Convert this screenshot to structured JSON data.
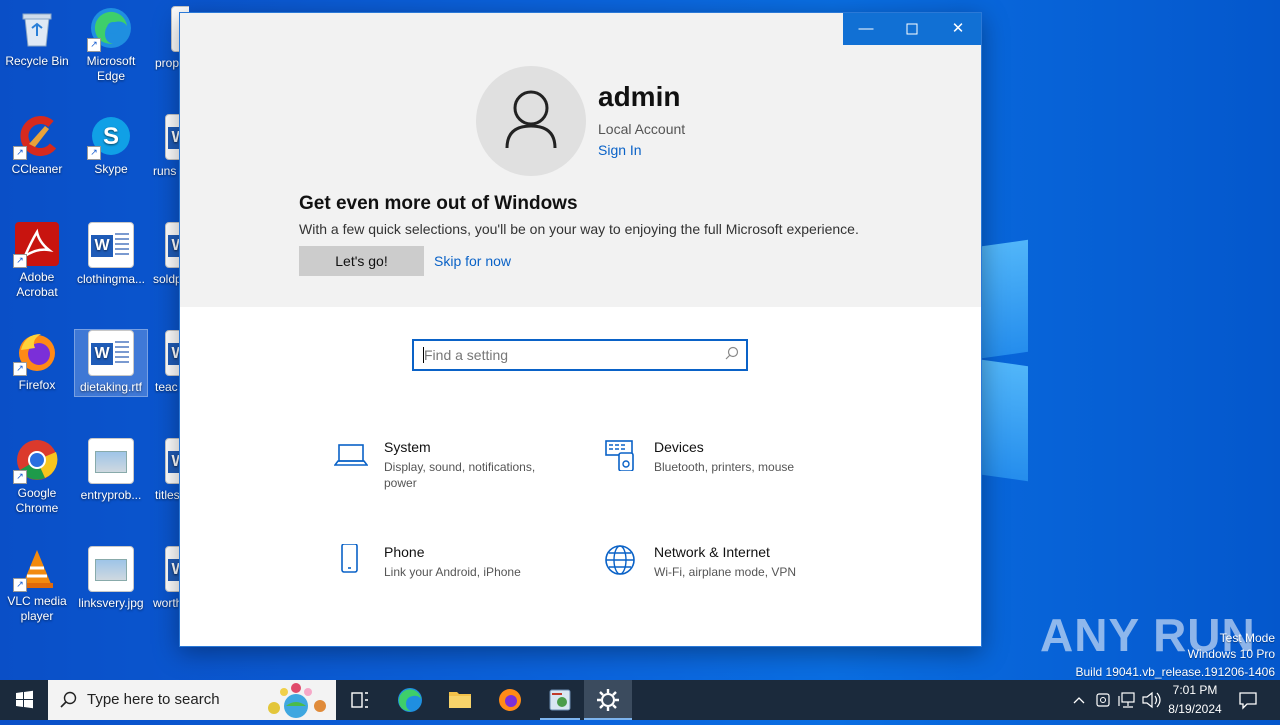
{
  "desktop": {
    "icons": [
      {
        "label": "Recycle Bin"
      },
      {
        "label": "Microsoft Edge"
      },
      {
        "label": "prop"
      },
      {
        "label": "CCleaner"
      },
      {
        "label": "Skype"
      },
      {
        "label": "runs"
      },
      {
        "label": "Adobe Acrobat"
      },
      {
        "label": "clothingma..."
      },
      {
        "label": "soldp"
      },
      {
        "label": "Firefox"
      },
      {
        "label": "dietaking.rtf"
      },
      {
        "label": "teac"
      },
      {
        "label": "Google Chrome"
      },
      {
        "label": "entryprob..."
      },
      {
        "label": "titles"
      },
      {
        "label": "VLC media player"
      },
      {
        "label": "linksvery.jpg"
      },
      {
        "label": "worth"
      }
    ]
  },
  "settings": {
    "user_name": "admin",
    "account_type": "Local Account",
    "sign_in": "Sign In",
    "promo_title": "Get even more out of Windows",
    "promo_body": "With a few quick selections, you'll be on your way to enjoying the full Microsoft experience.",
    "lets_go": "Let's go!",
    "skip": "Skip for now",
    "search_placeholder": "Find a setting",
    "tiles": [
      {
        "title": "System",
        "desc": "Display, sound, notifications, power",
        "icon": "laptop-icon"
      },
      {
        "title": "Devices",
        "desc": "Bluetooth, printers, mouse",
        "icon": "devices-icon"
      },
      {
        "title": "Phone",
        "desc": "Link your Android, iPhone",
        "icon": "phone-icon"
      },
      {
        "title": "Network & Internet",
        "desc": "Wi-Fi, airplane mode, VPN",
        "icon": "globe-icon"
      }
    ]
  },
  "taskbar": {
    "search_text": "Type here to search",
    "time": "7:01 PM",
    "date": "8/19/2024"
  },
  "watermark": {
    "brand": "ANY RUN",
    "line1": "Test Mode",
    "line2": "Windows 10 Pro",
    "line3": "Build 19041.vb_release.191206-1406"
  },
  "colors": {
    "accent": "#1170d4",
    "link": "#0a62c7",
    "taskbar": "#1b2a3c"
  }
}
